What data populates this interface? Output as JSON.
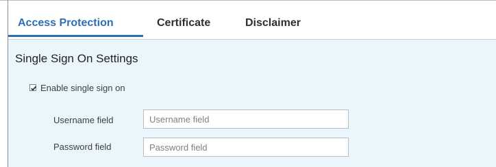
{
  "tabs": [
    {
      "label": "Access Protection",
      "active": true
    },
    {
      "label": "Certificate",
      "active": false
    },
    {
      "label": "Disclaimer",
      "active": false
    }
  ],
  "section": {
    "title": "Single Sign On Settings",
    "enable_sso": {
      "label": "Enable single sign on",
      "checked": true
    },
    "username": {
      "label": "Username field",
      "placeholder": "Username field",
      "value": ""
    },
    "password": {
      "label": "Password field",
      "placeholder": "Password field",
      "value": ""
    }
  },
  "colors": {
    "accent": "#2b6fb4",
    "panel_background": "#eaf5fc"
  }
}
